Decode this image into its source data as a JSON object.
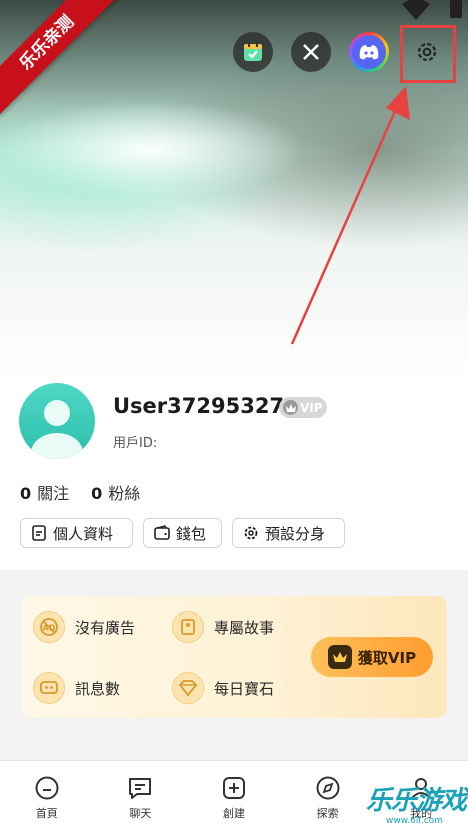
{
  "badge": {
    "text": "乐乐亲测"
  },
  "top_icons": [
    "calendar-check-icon",
    "x-icon",
    "discord-icon",
    "gear-icon"
  ],
  "profile": {
    "username": "User37295327",
    "vip_tag": "VIP",
    "user_id_label": "用戶ID:"
  },
  "follow": {
    "following_count": "0",
    "following_label": "關注",
    "followers_count": "0",
    "followers_label": "粉絲"
  },
  "chips": {
    "profile": "個人資料",
    "wallet": "錢包",
    "preset": "預設分身"
  },
  "vip_card": {
    "perks": [
      "沒有廣告",
      "專屬故事",
      "訊息數",
      "每日寶石"
    ],
    "button": "獲取VIP"
  },
  "nav": {
    "items": [
      "首頁",
      "聊天",
      "創建",
      "探索",
      "我的"
    ]
  },
  "watermark": {
    "text": "乐乐游戏",
    "url": "www.6ll.com"
  },
  "colors": {
    "accent": "#ff9d2f",
    "highlight": "#e8413f",
    "badge": "#c8101a"
  }
}
